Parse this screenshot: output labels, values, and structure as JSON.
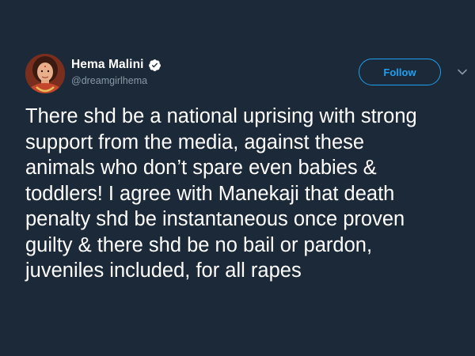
{
  "tweet": {
    "author": {
      "display_name": "Hema Malini",
      "handle": "@dreamgirlhema",
      "verified_icon": "verified-badge-icon"
    },
    "follow_label": "Follow",
    "menu_icon": "chevron-down-icon",
    "text": "There shd be a national uprising with strong\nsupport from the media, against these\nanimals who don’t  spare even babies &\ntoddlers! I agree with Manekaji that death\npenalty shd be instantaneous once proven\nguilty & there shd be no bail or pardon,\njuveniles included, for all rapes"
  },
  "colors": {
    "background": "#1c2938",
    "text_primary": "#ffffff",
    "text_secondary": "#8899a6",
    "accent": "#1da1f2"
  }
}
